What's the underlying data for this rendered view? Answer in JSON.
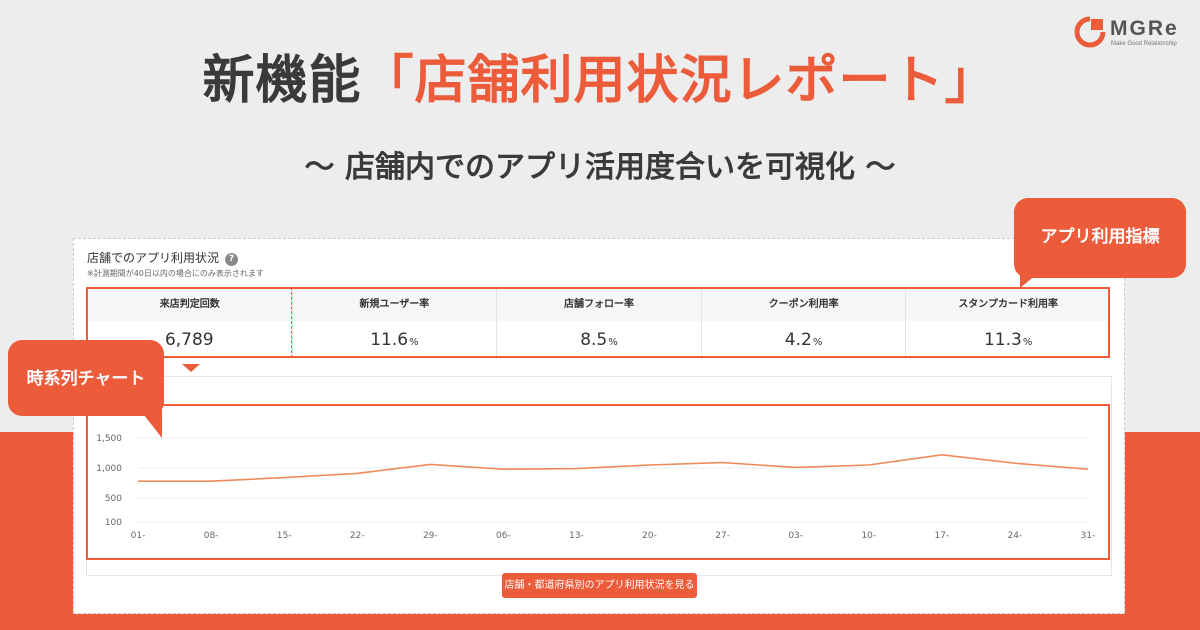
{
  "colors": {
    "accent": "#ec5b3a",
    "background": "#ededed",
    "line": "#f08a5a"
  },
  "logo": {
    "brand": "MGRe",
    "tagline": "Make Good Relationship",
    "mark_icon": "mgre-logo-mark"
  },
  "headline": {
    "prefix": "新機能",
    "highlight": "「店舗利用状況レポート」"
  },
  "subline": "〜 店舗内でのアプリ活用度合いを可視化 〜",
  "card": {
    "title": "店舗でのアプリ利用状況",
    "help_icon_glyph": "?",
    "note": "※計測期間が40日以内の場合にのみ表示されます"
  },
  "metrics": [
    {
      "label": "来店判定回数",
      "value": "6,789",
      "unit": ""
    },
    {
      "label": "新規ユーザー率",
      "value": "11.6",
      "unit": "%"
    },
    {
      "label": "店舗フォロー率",
      "value": "8.5",
      "unit": "%"
    },
    {
      "label": "クーポン利用率",
      "value": "4.2",
      "unit": "%"
    },
    {
      "label": "スタンプカード利用率",
      "value": "11.3",
      "unit": "%"
    }
  ],
  "callouts": {
    "app_metrics": "アプリ利用指標",
    "time_series": "時系列チャート"
  },
  "cta_label": "店舗・都道府県別のアプリ利用状況を見る",
  "chart_data": {
    "type": "line",
    "x": [
      "01-",
      "08-",
      "15-",
      "22-",
      "29-",
      "06-",
      "13-",
      "20-",
      "27-",
      "03-",
      "10-",
      "17-",
      "24-",
      "31-"
    ],
    "series": [
      {
        "values": [
          780,
          780,
          840,
          910,
          1060,
          980,
          990,
          1050,
          1090,
          1010,
          1050,
          1220,
          1080,
          980
        ]
      }
    ],
    "yticks": [
      "1,500",
      "1,000",
      "500",
      "100"
    ],
    "ytick_values": [
      1500,
      1000,
      500,
      100
    ],
    "ylim": [
      100,
      1500
    ],
    "grid": true
  }
}
